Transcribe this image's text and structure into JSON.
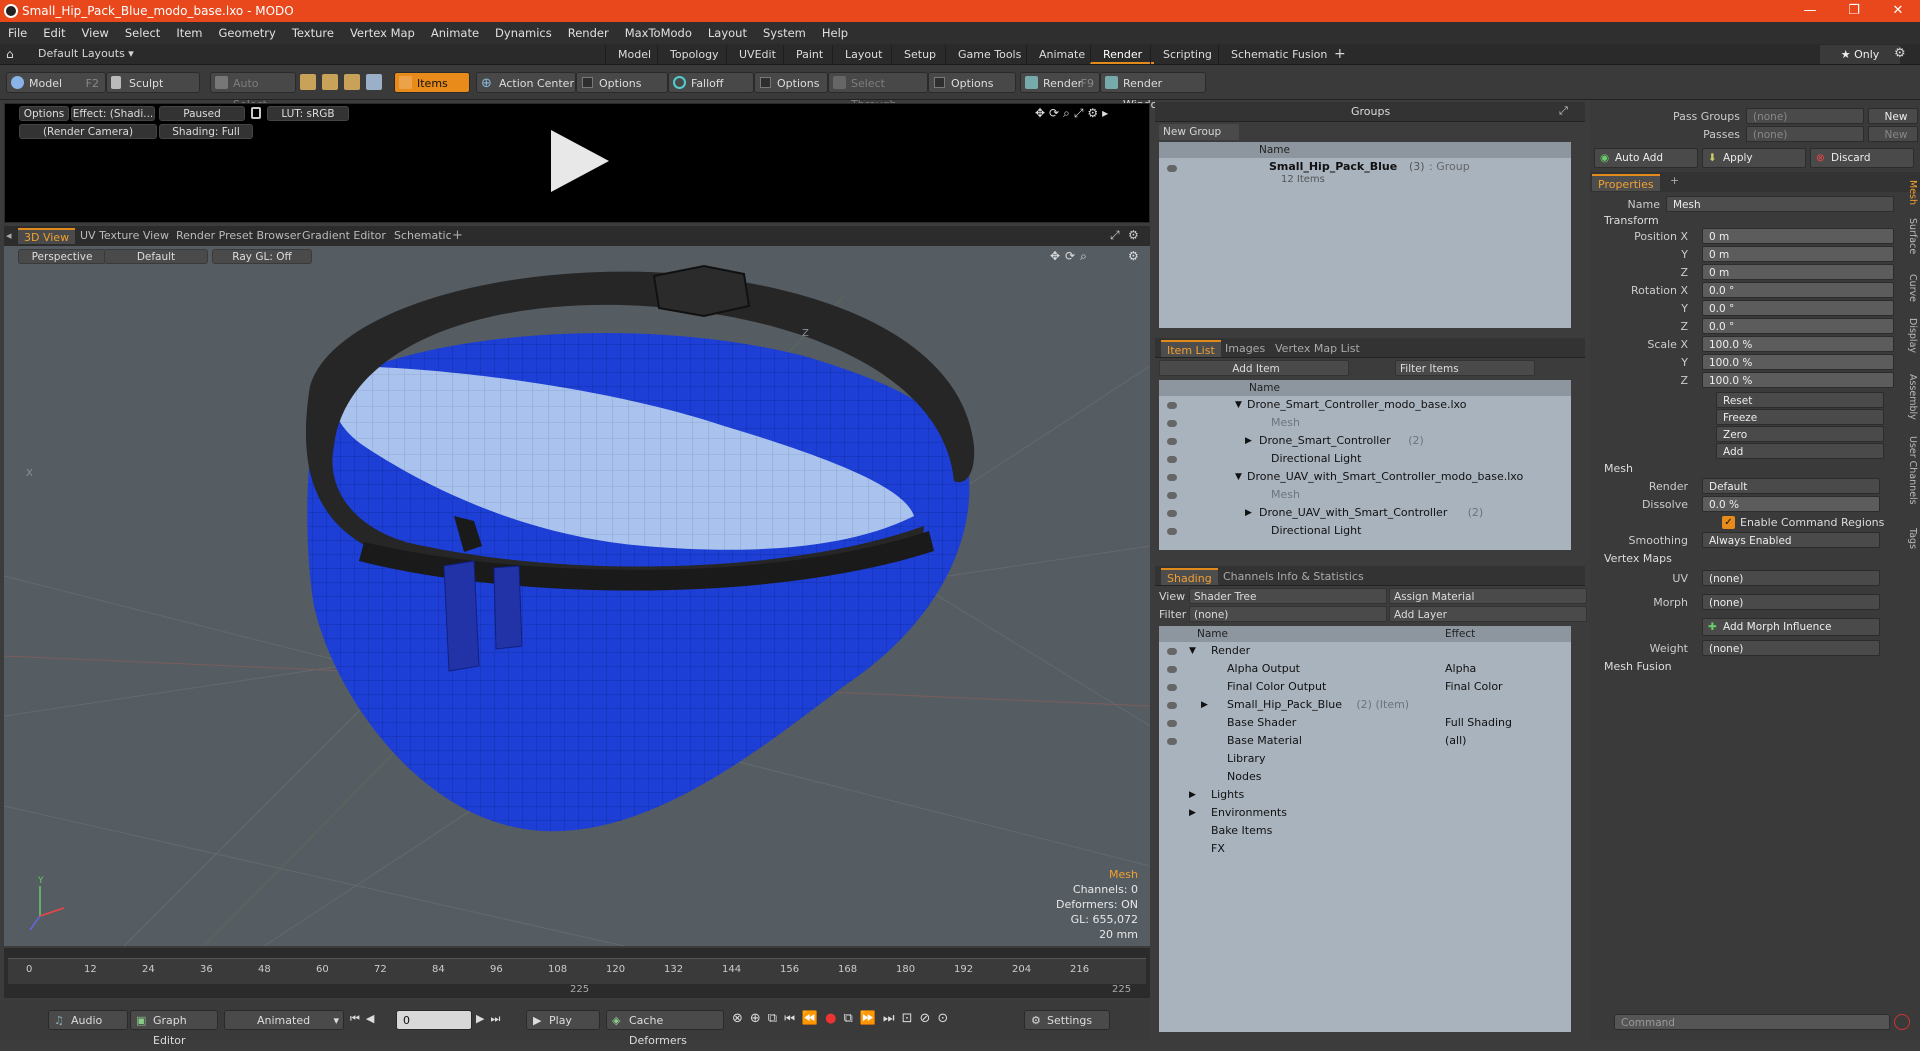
{
  "window": {
    "title": "Small_Hip_Pack_Blue_modo_base.lxo - MODO",
    "minimize": "—",
    "maximize": "❐",
    "close": "✕"
  },
  "menu": [
    "File",
    "Edit",
    "View",
    "Select",
    "Item",
    "Geometry",
    "Texture",
    "Vertex Map",
    "Animate",
    "Dynamics",
    "Render",
    "MaxToModo",
    "Layout",
    "System",
    "Help"
  ],
  "layoutbar": {
    "layouts": "Default Layouts ▾",
    "tabs": [
      "Model",
      "Topology",
      "UVEdit",
      "Paint",
      "Layout",
      "Setup",
      "Game Tools",
      "Animate",
      "Render",
      "Scripting",
      "Schematic Fusion"
    ],
    "active": "Render",
    "add": "+",
    "only": "★ Only",
    "gear": "⚙"
  },
  "toolbar": {
    "model": "Model",
    "model_key": "F2",
    "sculpt": "Sculpt",
    "auto_select": "Auto Select",
    "items": "Items",
    "action_center": "Action Center",
    "options1": "Options",
    "falloff": "Falloff",
    "options2": "Options",
    "select_through": "Select Through",
    "options3": "Options",
    "render": "Render",
    "render_key": "F9",
    "render_window": "Render Window"
  },
  "preview": {
    "options": "Options",
    "effect": "Effect: (Shadi...",
    "paused": "Paused",
    "lut": "LUT: sRGB",
    "camera": "(Render Camera)",
    "shading": "Shading: Full"
  },
  "viewtabs": [
    "3D View",
    "UV Texture View",
    "Render Preset Browser",
    "Gradient Editor",
    "Schematic"
  ],
  "viewport": {
    "perspective": "Perspective",
    "default": "Default",
    "raygl": "Ray GL: Off",
    "info_title": "Mesh",
    "info": [
      "Channels: 0",
      "Deformers: ON",
      "GL: 655,072",
      "20 mm"
    ],
    "axis_x": "X",
    "axis_z": "Z",
    "axis_y": "Y"
  },
  "timeline": {
    "ticks": [
      "0",
      "12",
      "24",
      "36",
      "48",
      "60",
      "72",
      "84",
      "96",
      "108",
      "120",
      "132",
      "144",
      "156",
      "168",
      "180",
      "192",
      "204",
      "216"
    ],
    "start": "0",
    "end": "225",
    "mid": "225"
  },
  "bottombar": {
    "audio": "Audio",
    "graph_editor": "Graph Editor",
    "animated": "Animated",
    "frame": "0",
    "play": "Play",
    "cache": "Cache Deformers",
    "settings": "Settings"
  },
  "groups": {
    "title": "Groups",
    "new_group": "New Group",
    "col_name": "Name",
    "item": "Small_Hip_Pack_Blue",
    "item_count": "(3)",
    "item_type": ": Group",
    "item_sub": "12 Items"
  },
  "itemlist": {
    "tabs": [
      "Item List",
      "Images",
      "Vertex Map List"
    ],
    "add_item": "Add Item",
    "filter": "Filter Items",
    "col_name": "Name",
    "rows": [
      {
        "t": "Drone_Smart_Controller_modo_base.lxo",
        "d": 0,
        "dim": false,
        "pre": "▼"
      },
      {
        "t": "Mesh",
        "d": 2,
        "dim": true,
        "pre": ""
      },
      {
        "t": "Drone_Smart_Controller",
        "extra": "(2)",
        "d": 1,
        "dim": false,
        "pre": "▶"
      },
      {
        "t": "Directional Light",
        "d": 2,
        "dim": false,
        "pre": ""
      },
      {
        "t": "Drone_UAV_with_Smart_Controller_modo_base.lxo",
        "d": 0,
        "dim": false,
        "pre": "▼"
      },
      {
        "t": "Mesh",
        "d": 2,
        "dim": true,
        "pre": ""
      },
      {
        "t": "Drone_UAV_with_Smart_Controller",
        "extra": "(2)",
        "d": 1,
        "dim": false,
        "pre": "▶"
      },
      {
        "t": "Directional Light",
        "d": 2,
        "dim": false,
        "pre": ""
      }
    ]
  },
  "shading": {
    "tabs": [
      "Shading",
      "Channels",
      "Info & Statistics"
    ],
    "view_label": "View",
    "view": "Shader Tree",
    "assign": "Assign Material",
    "filter_label": "Filter",
    "filter": "(none)",
    "add_layer": "Add Layer",
    "col_name": "Name",
    "col_effect": "Effect",
    "rows": [
      {
        "t": "Render",
        "e": "",
        "d": 0,
        "pre": "▼"
      },
      {
        "t": "Alpha Output",
        "e": "Alpha",
        "d": 1,
        "pre": ""
      },
      {
        "t": "Final Color Output",
        "e": "Final Color",
        "d": 1,
        "pre": ""
      },
      {
        "t": "Small_Hip_Pack_Blue",
        "extra": "(2) (Item)",
        "e": "",
        "d": 1,
        "pre": "▶"
      },
      {
        "t": "Base Shader",
        "e": "Full Shading",
        "d": 1,
        "pre": ""
      },
      {
        "t": "Base Material",
        "e": "(all)",
        "d": 1,
        "pre": ""
      },
      {
        "t": "Library",
        "e": "",
        "d": 1,
        "pre": ""
      },
      {
        "t": "Nodes",
        "e": "",
        "d": 1,
        "pre": ""
      },
      {
        "t": "Lights",
        "e": "",
        "d": 0,
        "pre": "▶"
      },
      {
        "t": "Environments",
        "e": "",
        "d": 0,
        "pre": "▶"
      },
      {
        "t": "Bake Items",
        "e": "",
        "d": 0,
        "pre": ""
      },
      {
        "t": "FX",
        "e": "",
        "d": 0,
        "pre": ""
      }
    ]
  },
  "right": {
    "pass_groups": "Pass Groups",
    "passes": "Passes",
    "none": "(none)",
    "new": "New",
    "auto_add": "Auto Add",
    "apply": "Apply",
    "discard": "Discard",
    "properties": "Properties",
    "name_label": "Name",
    "name": "Mesh",
    "transform": "Transform",
    "position_x": "Position X",
    "y": "Y",
    "z": "Z",
    "pos": [
      "0 m",
      "0 m",
      "0 m"
    ],
    "rotation_x": "Rotation X",
    "rot": [
      "0.0 °",
      "0.0 °",
      "0.0 °"
    ],
    "scale_x": "Scale X",
    "scale": [
      "100.0 %",
      "100.0 %",
      "100.0 %"
    ],
    "reset": "Reset",
    "freeze": "Freeze",
    "zero": "Zero",
    "add": "Add",
    "mesh": "Mesh",
    "render_label": "Render",
    "render": "Default",
    "dissolve_label": "Dissolve",
    "dissolve": "0.0 %",
    "ecr": "Enable Command Regions",
    "smoothing_label": "Smoothing",
    "smoothing": "Always Enabled",
    "vertex_maps": "Vertex Maps",
    "uv_label": "UV",
    "uv": "(none)",
    "morph_label": "Morph",
    "morph": "(none)",
    "add_morph": "Add Morph Influence",
    "weight_label": "Weight",
    "weight": "(none)",
    "mesh_fusion": "Mesh Fusion",
    "command": "Command",
    "side_tabs": [
      "Mesh",
      "Surface",
      "Curve",
      "Display",
      "Assembly",
      "User Channels",
      "Tags"
    ]
  }
}
